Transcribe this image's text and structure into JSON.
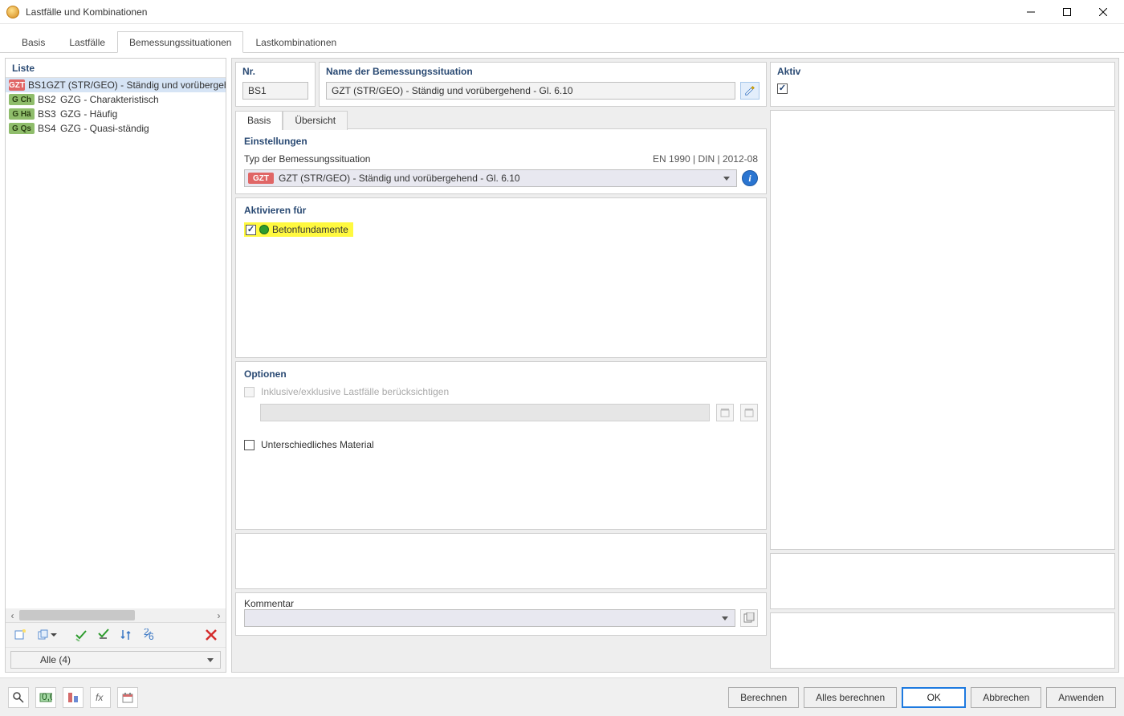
{
  "window": {
    "title": "Lastfälle und Kombinationen"
  },
  "mainTabs": {
    "items": [
      {
        "label": "Basis"
      },
      {
        "label": "Lastfälle"
      },
      {
        "label": "Bemessungssituationen"
      },
      {
        "label": "Lastkombinationen"
      }
    ]
  },
  "left": {
    "header": "Liste",
    "items": [
      {
        "badge": "GZT",
        "badgeClass": "red",
        "code": "BS1",
        "label": "GZT (STR/GEO) - Ständig und vorübergehend"
      },
      {
        "badge": "G Ch",
        "badgeClass": "green",
        "code": "BS2",
        "label": "GZG - Charakteristisch"
      },
      {
        "badge": "G Hä",
        "badgeClass": "green",
        "code": "BS3",
        "label": "GZG - Häufig"
      },
      {
        "badge": "G Qs",
        "badgeClass": "green",
        "code": "BS4",
        "label": "GZG - Quasi-ständig"
      }
    ],
    "filter": "Alle (4)"
  },
  "fields": {
    "nrLabel": "Nr.",
    "nrValue": "BS1",
    "nameLabel": "Name der Bemessungssituation",
    "nameValue": "GZT (STR/GEO) - Ständig und vorübergehend - Gl. 6.10",
    "aktivLabel": "Aktiv"
  },
  "subTabs": {
    "t1": "Basis",
    "t2": "Übersicht"
  },
  "settings": {
    "header": "Einstellungen",
    "typeLabel": "Typ der Bemessungssituation",
    "norm": "EN 1990 | DIN | 2012-08",
    "typeBadge": "GZT",
    "typeValue": "GZT (STR/GEO) - Ständig und vorübergehend - Gl. 6.10"
  },
  "activate": {
    "header": "Aktivieren für",
    "item1": "Betonfundamente"
  },
  "options": {
    "header": "Optionen",
    "opt1": "Inklusive/exklusive Lastfälle berücksichtigen",
    "opt2": "Unterschiedliches Material"
  },
  "comment": {
    "header": "Kommentar"
  },
  "footer": {
    "calc": "Berechnen",
    "calcAll": "Alles berechnen",
    "ok": "OK",
    "cancel": "Abbrechen",
    "apply": "Anwenden"
  }
}
